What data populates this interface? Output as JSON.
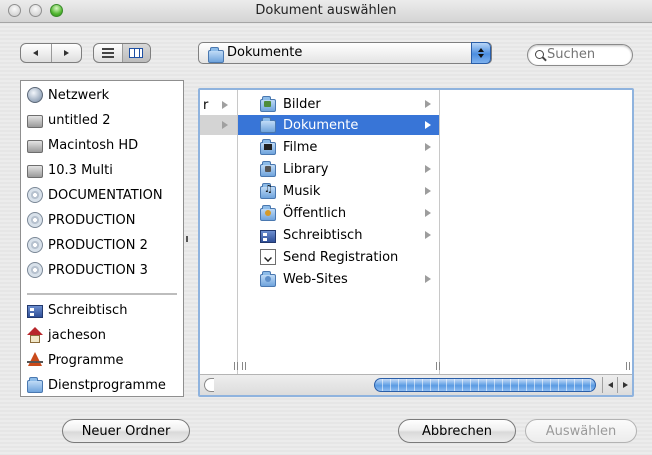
{
  "window": {
    "title": "Dokument auswählen"
  },
  "toolbar": {
    "back_icon": "back-arrow-icon",
    "forward_icon": "forward-arrow-icon",
    "view_list_icon": "list-view-icon",
    "view_column_icon": "column-view-icon",
    "path_popup_value": "Dokumente",
    "search_placeholder": "Suchen"
  },
  "sidebar": {
    "devices": [
      {
        "label": "Netzwerk",
        "icon": "network-globe-icon"
      },
      {
        "label": "untitled 2",
        "icon": "hard-disk-icon"
      },
      {
        "label": "Macintosh HD",
        "icon": "hard-disk-icon"
      },
      {
        "label": "10.3 Multi",
        "icon": "hard-disk-icon"
      },
      {
        "label": "DOCUMENTATION",
        "icon": "cd-disc-icon"
      },
      {
        "label": "PRODUCTION",
        "icon": "cd-disc-icon"
      },
      {
        "label": "PRODUCTION 2",
        "icon": "cd-disc-icon"
      },
      {
        "label": "PRODUCTION 3",
        "icon": "cd-disc-icon"
      }
    ],
    "places": [
      {
        "label": "Schreibtisch",
        "icon": "desktop-icon"
      },
      {
        "label": "jacheson",
        "icon": "home-icon"
      },
      {
        "label": "Programme",
        "icon": "applications-icon"
      },
      {
        "label": "Dienstprogramme",
        "icon": "folder-icon"
      }
    ]
  },
  "browser": {
    "column1_fragment": "r",
    "column2_items": [
      {
        "label": "Bilder",
        "icon": "pictures-folder-icon",
        "selected": false,
        "has_children": true
      },
      {
        "label": "Dokumente",
        "icon": "documents-folder-icon",
        "selected": true,
        "has_children": true
      },
      {
        "label": "Filme",
        "icon": "movies-folder-icon",
        "selected": false,
        "has_children": true
      },
      {
        "label": "Library",
        "icon": "library-folder-icon",
        "selected": false,
        "has_children": true
      },
      {
        "label": "Musik",
        "icon": "music-folder-icon",
        "selected": false,
        "has_children": true
      },
      {
        "label": "Öffentlich",
        "icon": "public-folder-icon",
        "selected": false,
        "has_children": true
      },
      {
        "label": "Schreibtisch",
        "icon": "desktop-folder-icon",
        "selected": false,
        "has_children": true
      },
      {
        "label": "Send Registration",
        "icon": "document-file-icon",
        "selected": false,
        "has_children": false
      },
      {
        "label": "Web-Sites",
        "icon": "sites-folder-icon",
        "selected": false,
        "has_children": true
      }
    ],
    "column3_items": []
  },
  "buttons": {
    "new_folder": "Neuer Ordner",
    "cancel": "Abbrechen",
    "choose": "Auswählen"
  },
  "colors": {
    "selection": "#3875d7",
    "scroll_thumb": "#5a9be3"
  }
}
